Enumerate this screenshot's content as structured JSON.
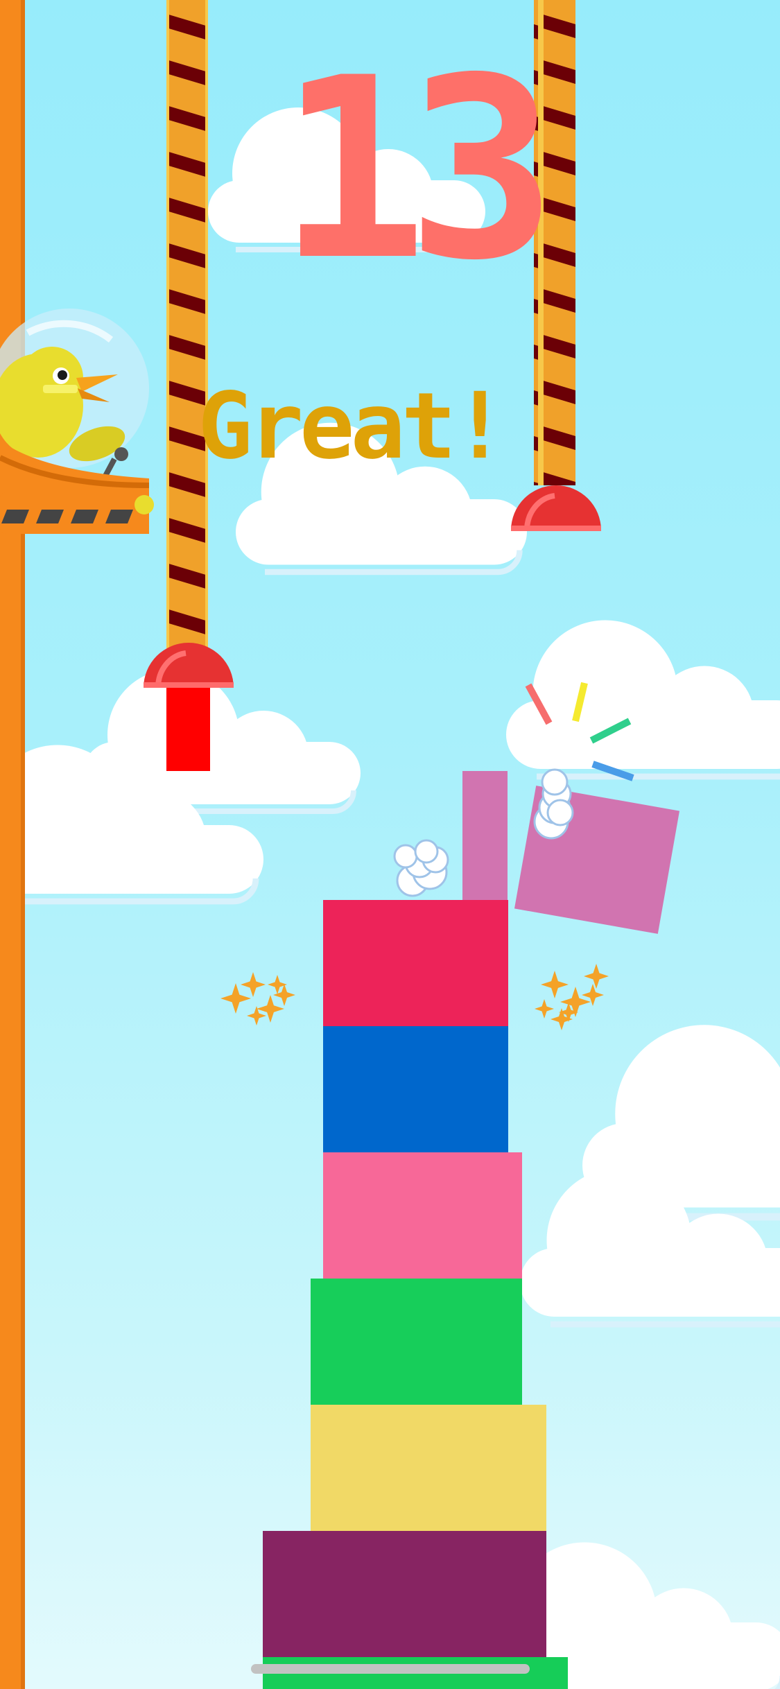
{
  "game": {
    "score": "13",
    "praise": "Great!"
  },
  "tower": {
    "blocks": [
      {
        "color": "#ed2359"
      },
      {
        "color": "#0067cc"
      },
      {
        "color": "#f76898"
      },
      {
        "color": "#17ce5a"
      },
      {
        "color": "#f1d966"
      },
      {
        "color": "#872462"
      },
      {
        "color": "#16cd58"
      }
    ],
    "falling_block_color": "#d174b0"
  },
  "crane": {
    "rope_colors": [
      "#f0a12a",
      "#6b0006"
    ],
    "cap_color": "#e63232",
    "hanging_block_color": "#ff0000"
  },
  "character": {
    "name": "duck",
    "pod_color": "#f6891c",
    "body_color": "#e8dd2e"
  },
  "colors": {
    "sky_top": "#97ecfb",
    "pole": "#f6891c",
    "score": "#fe7069",
    "praise": "#dea208",
    "sparks": "#f4a228"
  }
}
